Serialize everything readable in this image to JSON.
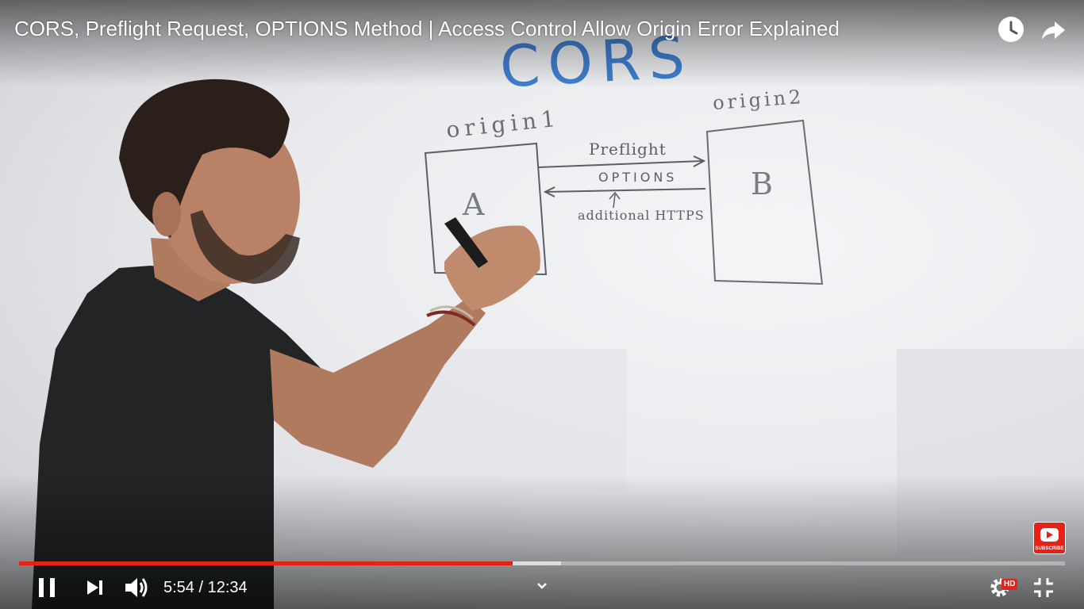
{
  "video": {
    "title": "CORS, Preflight Request, OPTIONS Method | Access Control Allow Origin Error Explained"
  },
  "whiteboard": {
    "heading": "CORS",
    "origin1_label": "origin1",
    "origin2_label": "origin2",
    "box_a_label": "A",
    "box_b_label": "B",
    "arrow_top_label": "Preflight",
    "arrow_bottom_label": "OPTIONS",
    "annotation": "additional HTTPS"
  },
  "player": {
    "current_time": "5:54",
    "separator": " / ",
    "duration": "12:34",
    "played_fraction": 0.472,
    "buffered_fraction": 0.518,
    "quality_badge": "HD",
    "subscribe_label": "SUBSCRIBE",
    "accent_color": "#e62117"
  },
  "icons": {
    "watch_later": "clock-icon",
    "share": "share-arrow-icon",
    "play_pause": "pause-icon",
    "next": "skip-next-icon",
    "volume": "volume-high-icon",
    "expand": "chevron-down-icon",
    "settings": "gear-icon",
    "fullscreen": "exit-fullscreen-icon",
    "subscribe": "youtube-logo-icon"
  }
}
